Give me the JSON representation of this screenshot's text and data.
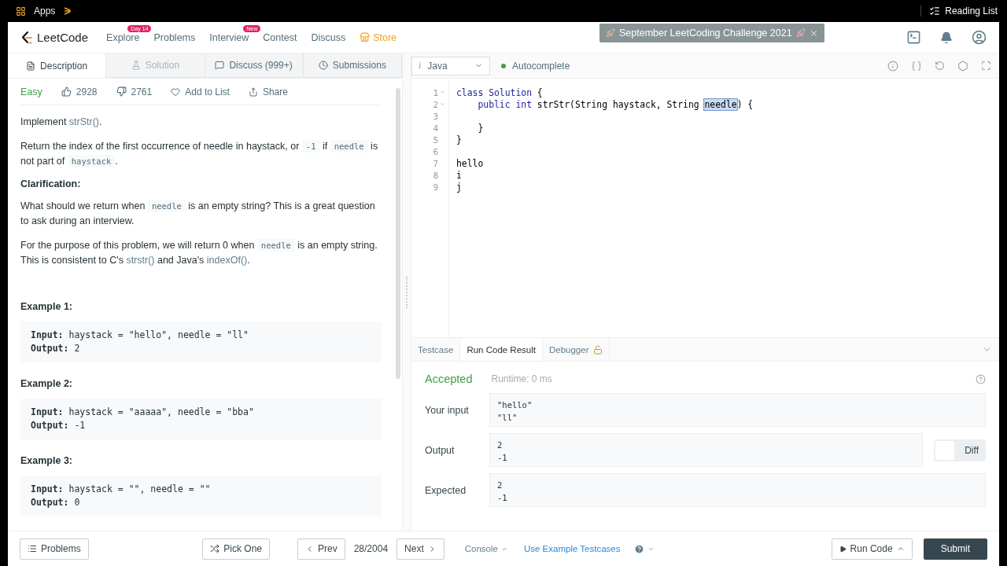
{
  "browser": {
    "apps_label": "Apps",
    "reading_list": "Reading List"
  },
  "nav": {
    "logo": "LeetCode",
    "items": [
      {
        "label": "Explore",
        "kind": "link",
        "badge": "Day 14"
      },
      {
        "label": "Problems",
        "kind": "link"
      },
      {
        "label": "Interview",
        "kind": "link",
        "badge": "New"
      },
      {
        "label": "Contest",
        "kind": "link"
      },
      {
        "label": "Discuss",
        "kind": "link"
      },
      {
        "label": "Store",
        "kind": "store"
      }
    ],
    "banner": "September LeetCoding Challenge 2021"
  },
  "problem_tabs": [
    {
      "label": "Description",
      "kind": "description",
      "selected": true,
      "disabled": false
    },
    {
      "label": "Solution",
      "kind": "solution",
      "selected": false,
      "disabled": true
    },
    {
      "label": "Discuss (999+)",
      "kind": "discuss",
      "selected": false,
      "disabled": false
    },
    {
      "label": "Submissions",
      "kind": "submissions",
      "selected": false,
      "disabled": false
    }
  ],
  "problem": {
    "difficulty": "Easy",
    "likes": "2928",
    "dislikes": "2761",
    "add_to_list": "Add to List",
    "share": "Share",
    "blocks": [
      {
        "kind": "para",
        "segments": [
          {
            "kind": "text",
            "text": "Implement "
          },
          {
            "kind": "link",
            "text": "strStr()"
          },
          {
            "kind": "text",
            "text": "."
          }
        ]
      },
      {
        "kind": "para",
        "segments": [
          {
            "kind": "text",
            "text": "Return the index of the first occurrence of needle in haystack, or "
          },
          {
            "kind": "code",
            "text": "-1"
          },
          {
            "kind": "text",
            "text": " if "
          },
          {
            "kind": "code",
            "text": "needle"
          },
          {
            "kind": "text",
            "text": " is not part of "
          },
          {
            "kind": "code",
            "text": "haystack"
          },
          {
            "kind": "text",
            "text": "."
          }
        ]
      },
      {
        "kind": "heading",
        "segments": [
          {
            "kind": "text",
            "text": "Clarification:"
          }
        ]
      },
      {
        "kind": "para",
        "segments": [
          {
            "kind": "text",
            "text": "What should we return when "
          },
          {
            "kind": "code",
            "text": "needle"
          },
          {
            "kind": "text",
            "text": " is an empty string? This is a great question to ask during an interview."
          }
        ]
      },
      {
        "kind": "para",
        "segments": [
          {
            "kind": "text",
            "text": "For the purpose of this problem, we will return 0 when "
          },
          {
            "kind": "code",
            "text": "needle"
          },
          {
            "kind": "text",
            "text": " is an empty string. This is consistent to C's "
          },
          {
            "kind": "link",
            "text": "strstr()"
          },
          {
            "kind": "text",
            "text": " and Java's "
          },
          {
            "kind": "link",
            "text": "indexOf()"
          },
          {
            "kind": "text",
            "text": "."
          }
        ]
      }
    ],
    "examples": [
      {
        "title": "Example 1:",
        "input_label": "Input:",
        "input": "haystack = \"hello\", needle = \"ll\"",
        "output_label": "Output:",
        "output": "2"
      },
      {
        "title": "Example 2:",
        "input_label": "Input:",
        "input": "haystack = \"aaaaa\", needle = \"bba\"",
        "output_label": "Output:",
        "output": "-1"
      },
      {
        "title": "Example 3:",
        "input_label": "Input:",
        "input": "haystack = \"\", needle = \"\"",
        "output_label": "Output:",
        "output": "0"
      }
    ]
  },
  "editor": {
    "language_icon": "i",
    "language": "Java",
    "autocomplete": "Autocomplete",
    "autocomplete_on": true,
    "lines": [
      {
        "number": "1",
        "foldable": true,
        "segments": [
          {
            "kind": "keyword",
            "text": "class Solution"
          },
          {
            "kind": "plain",
            "text": " {"
          }
        ]
      },
      {
        "number": "2",
        "foldable": true,
        "segments": [
          {
            "kind": "keyword",
            "text": "    public int"
          },
          {
            "kind": "plain",
            "text": " strStr(String haystack, String "
          },
          {
            "kind": "selected",
            "text": "needle"
          },
          {
            "kind": "plain",
            "text": ") {"
          }
        ]
      },
      {
        "number": "3",
        "foldable": false
      },
      {
        "number": "4",
        "foldable": false,
        "segments": [
          {
            "kind": "plain",
            "text": "    }"
          }
        ]
      },
      {
        "number": "5",
        "foldable": false,
        "segments": [
          {
            "kind": "plain",
            "text": "}"
          }
        ]
      },
      {
        "number": "6",
        "foldable": false
      },
      {
        "number": "7",
        "foldable": false,
        "segments": [
          {
            "kind": "plain",
            "text": "hello"
          }
        ]
      },
      {
        "number": "8",
        "foldable": false,
        "segments": [
          {
            "kind": "plain",
            "text": "i"
          }
        ]
      },
      {
        "number": "9",
        "foldable": false,
        "segments": [
          {
            "kind": "plain",
            "text": "j"
          }
        ]
      }
    ]
  },
  "result_tabs": [
    {
      "label": "Testcase",
      "selected": false,
      "locked": false
    },
    {
      "label": "Run Code Result",
      "selected": true,
      "locked": false
    },
    {
      "label": "Debugger",
      "selected": false,
      "locked": true
    }
  ],
  "result": {
    "status": "Accepted",
    "runtime": "Runtime: 0 ms",
    "rows": [
      {
        "label": "Your input",
        "lines": [
          "\"hello\"",
          "\"ll\""
        ]
      },
      {
        "label": "Output",
        "lines": [
          "2",
          "-1"
        ],
        "diff_toggle": {
          "label": "Diff",
          "on": false
        }
      },
      {
        "label": "Expected",
        "lines": [
          "2",
          "-1"
        ]
      }
    ]
  },
  "footer": {
    "problems": "Problems",
    "pick_one": "Pick One",
    "prev": "Prev",
    "position": "28/2004",
    "next": "Next",
    "console": "Console",
    "use_example": "Use Example Testcases",
    "run_code": "Run Code",
    "submit": "Submit"
  }
}
